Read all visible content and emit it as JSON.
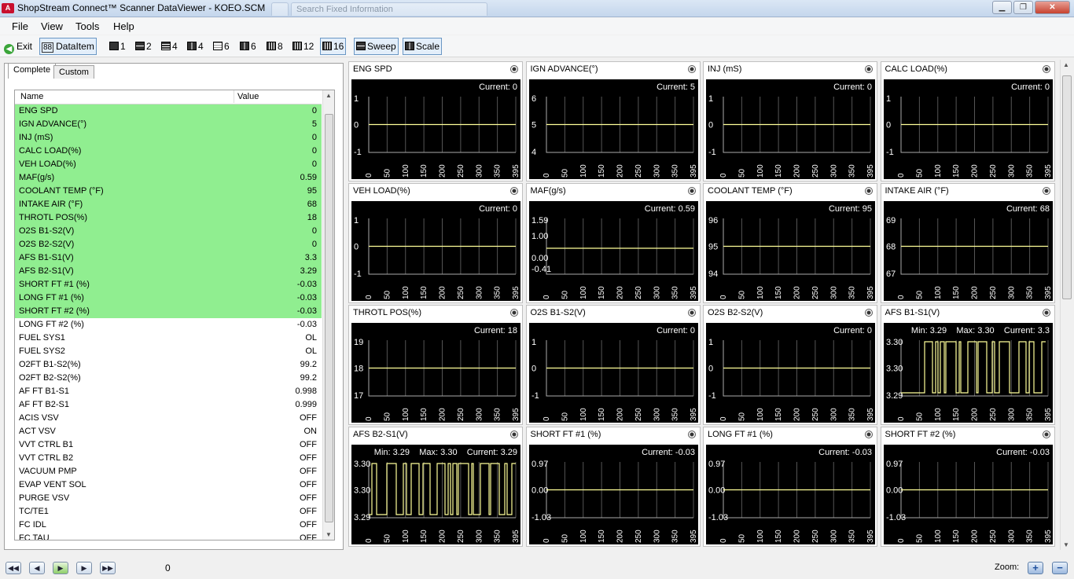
{
  "window": {
    "title": "ShopStream Connect™ Scanner DataViewer - KOEO.SCM",
    "ghost_tab_1": "",
    "ghost_tab_2": "Search Fixed Information",
    "app_icon_text": "A"
  },
  "menu": [
    "File",
    "View",
    "Tools",
    "Help"
  ],
  "toolbar": {
    "exit": "Exit",
    "dataitem": "DataItem",
    "layouts": [
      "1",
      "2",
      "4",
      "4",
      "6",
      "6",
      "8",
      "12",
      "16"
    ],
    "active_layout": "16",
    "sweep": "Sweep",
    "scale": "Scale"
  },
  "left_panel": {
    "tabs": [
      "Complete",
      "Custom"
    ],
    "active_tab": "Complete",
    "columns": [
      "Name",
      "Value"
    ],
    "highlight_color": "#90ee90",
    "rows": [
      {
        "name": "ENG SPD",
        "value": "0",
        "hl": true
      },
      {
        "name": "IGN ADVANCE(°)",
        "value": "5",
        "hl": true
      },
      {
        "name": "INJ (mS)",
        "value": "0",
        "hl": true
      },
      {
        "name": "CALC LOAD(%)",
        "value": "0",
        "hl": true
      },
      {
        "name": "VEH LOAD(%)",
        "value": "0",
        "hl": true
      },
      {
        "name": "MAF(g/s)",
        "value": "0.59",
        "hl": true
      },
      {
        "name": "COOLANT TEMP (°F)",
        "value": "95",
        "hl": true
      },
      {
        "name": "INTAKE AIR (°F)",
        "value": "68",
        "hl": true
      },
      {
        "name": "THROTL POS(%)",
        "value": "18",
        "hl": true
      },
      {
        "name": "O2S B1-S2(V)",
        "value": "0",
        "hl": true
      },
      {
        "name": "O2S B2-S2(V)",
        "value": "0",
        "hl": true
      },
      {
        "name": "AFS B1-S1(V)",
        "value": "3.3",
        "hl": true
      },
      {
        "name": "AFS B2-S1(V)",
        "value": "3.29",
        "hl": true
      },
      {
        "name": "SHORT FT #1 (%)",
        "value": "-0.03",
        "hl": true
      },
      {
        "name": "LONG FT #1 (%)",
        "value": "-0.03",
        "hl": true
      },
      {
        "name": "SHORT FT #2 (%)",
        "value": "-0.03",
        "hl": true
      },
      {
        "name": "LONG FT #2 (%)",
        "value": "-0.03",
        "hl": false
      },
      {
        "name": "FUEL SYS1",
        "value": "OL",
        "hl": false
      },
      {
        "name": "FUEL SYS2",
        "value": "OL",
        "hl": false
      },
      {
        "name": "O2FT B1-S2(%)",
        "value": "99.2",
        "hl": false
      },
      {
        "name": "O2FT B2-S2(%)",
        "value": "99.2",
        "hl": false
      },
      {
        "name": "AF FT B1-S1",
        "value": "0.998",
        "hl": false
      },
      {
        "name": "AF FT B2-S1",
        "value": "0.999",
        "hl": false
      },
      {
        "name": "ACIS VSV",
        "value": "OFF",
        "hl": false
      },
      {
        "name": "ACT VSV",
        "value": "ON",
        "hl": false
      },
      {
        "name": "VVT CTRL B1",
        "value": "OFF",
        "hl": false
      },
      {
        "name": "VVT CTRL B2",
        "value": "OFF",
        "hl": false
      },
      {
        "name": "VACUUM PMP",
        "value": "OFF",
        "hl": false
      },
      {
        "name": "EVAP VENT SOL",
        "value": "OFF",
        "hl": false
      },
      {
        "name": "PURGE VSV",
        "value": "OFF",
        "hl": false
      },
      {
        "name": "TC/TE1",
        "value": "OFF",
        "hl": false
      },
      {
        "name": "FC IDL",
        "value": "OFF",
        "hl": false
      },
      {
        "name": "FC TAU",
        "value": "OFF",
        "hl": false
      }
    ]
  },
  "graphs": {
    "x_ticks": [
      "0",
      "50",
      "100",
      "150",
      "200",
      "250",
      "300",
      "350",
      "395"
    ],
    "trace_color": "#ffff99",
    "background": "#000000",
    "grid_color": "#555555",
    "tiles": [
      {
        "title": "ENG SPD",
        "readout": "Current: 0",
        "y": [
          "1",
          "0",
          "-1"
        ],
        "trace": "flat"
      },
      {
        "title": "IGN ADVANCE(°)",
        "readout": "Current: 5",
        "y": [
          "6",
          "5",
          "4"
        ],
        "trace": "flat"
      },
      {
        "title": "INJ (mS)",
        "readout": "Current: 0",
        "y": [
          "1",
          "0",
          "-1"
        ],
        "trace": "flat"
      },
      {
        "title": "CALC LOAD(%)",
        "readout": "Current: 0",
        "y": [
          "1",
          "0",
          "-1"
        ],
        "trace": "flat"
      },
      {
        "title": "VEH LOAD(%)",
        "readout": "Current: 0",
        "y": [
          "1",
          "0",
          "-1"
        ],
        "trace": "flat"
      },
      {
        "title": "MAF(g/s)",
        "readout": "Current: 0.59",
        "y": [
          "1.59",
          "1.00",
          "0.00",
          "-0.41"
        ],
        "trace": "maf"
      },
      {
        "title": "COOLANT TEMP (°F)",
        "readout": "Current: 95",
        "y": [
          "96",
          "95",
          "94"
        ],
        "trace": "flat"
      },
      {
        "title": "INTAKE AIR (°F)",
        "readout": "Current: 68",
        "y": [
          "69",
          "68",
          "67"
        ],
        "trace": "flat"
      },
      {
        "title": "THROTL POS(%)",
        "readout": "Current: 18",
        "y": [
          "19",
          "18",
          "17"
        ],
        "trace": "flat"
      },
      {
        "title": "O2S B1-S2(V)",
        "readout": "Current: 0",
        "y": [
          "1",
          "0",
          "-1"
        ],
        "trace": "flat"
      },
      {
        "title": "O2S B2-S2(V)",
        "readout": "Current: 0",
        "y": [
          "1",
          "0",
          "-1"
        ],
        "trace": "flat"
      },
      {
        "title": "AFS B1-S1(V)",
        "readout": "Min: 3.29    Max: 3.30    Current: 3.3",
        "y": [
          "3.30",
          "3.30",
          "3.29"
        ],
        "trace": "square1"
      },
      {
        "title": "AFS B2-S1(V)",
        "readout": "Min: 3.29    Max: 3.30    Current: 3.29",
        "y": [
          "3.30",
          "3.30",
          "3.29"
        ],
        "trace": "square2"
      },
      {
        "title": "SHORT FT #1 (%)",
        "readout": "Current: -0.03",
        "y": [
          "0.97",
          "0.00",
          "-1.03"
        ],
        "trace": "flat"
      },
      {
        "title": "LONG FT #1 (%)",
        "readout": "Current: -0.03",
        "y": [
          "0.97",
          "0.00",
          "-1.03"
        ],
        "trace": "flat"
      },
      {
        "title": "SHORT FT #2 (%)",
        "readout": "Current: -0.03",
        "y": [
          "0.97",
          "0.00",
          "-1.03"
        ],
        "trace": "flat"
      }
    ]
  },
  "status": {
    "frame": "0",
    "zoom_label": "Zoom:",
    "zoom_in": "+",
    "zoom_out": "−",
    "nav": [
      "first",
      "prev",
      "play",
      "next",
      "last"
    ]
  }
}
